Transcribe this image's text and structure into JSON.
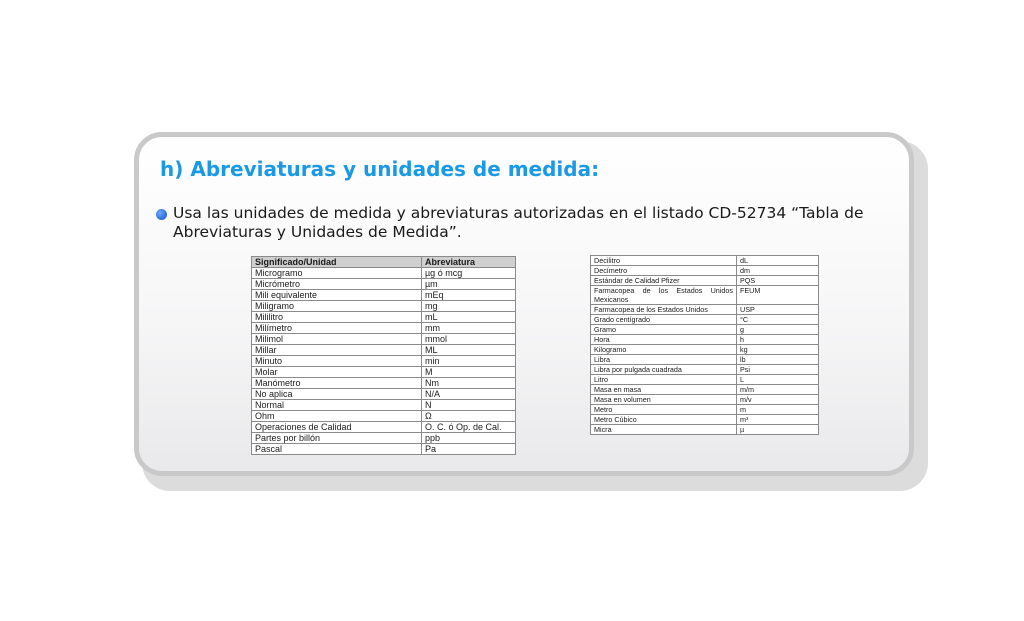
{
  "section": {
    "title": "h) Abreviaturas y unidades de medida:",
    "bullet": "Usa las unidades de medida y abreviaturas autorizadas en el listado CD-52734 “Tabla de Abreviaturas y Unidades de Medida”."
  },
  "table_left": {
    "headers": [
      "Significado/Unidad",
      "Abreviatura"
    ],
    "rows": [
      [
        "Microgramo",
        "µg ó mcg"
      ],
      [
        "Micrómetro",
        "µm"
      ],
      [
        "Mili equivalente",
        "mEq"
      ],
      [
        "Miligramo",
        "mg"
      ],
      [
        "Mililitro",
        "mL"
      ],
      [
        "Milímetro",
        "mm"
      ],
      [
        "Milimol",
        "mmol"
      ],
      [
        "Millar",
        "ML"
      ],
      [
        "Minuto",
        "min"
      ],
      [
        "Molar",
        "M"
      ],
      [
        "Manómetro",
        "Nm"
      ],
      [
        "No aplica",
        "N/A"
      ],
      [
        "Normal",
        "N"
      ],
      [
        "Ohm",
        "Ω"
      ],
      [
        "Operaciones de Calidad",
        "O. C. ó Op. de Cal."
      ],
      [
        "Partes por billón",
        "ppb"
      ],
      [
        "Pascal",
        "Pa"
      ]
    ]
  },
  "table_right": {
    "rows": [
      [
        "Decilitro",
        "dL"
      ],
      [
        "Decímetro",
        "dm"
      ],
      [
        "Estándar de Calidad Pfizer",
        "PQS"
      ],
      [
        "Farmacopea de los Estados Unidos Mexicanos",
        "FEUM"
      ],
      [
        "Farmacopea de los Estados Unidos",
        "USP"
      ],
      [
        "Grado centígrado",
        "°C"
      ],
      [
        "Gramo",
        "g"
      ],
      [
        "Hora",
        "h"
      ],
      [
        "Kilogramo",
        "kg"
      ],
      [
        "Libra",
        "lb"
      ],
      [
        "Libra por pulgada cuadrada",
        "Psi"
      ],
      [
        "Litro",
        "L"
      ],
      [
        "Masa en masa",
        "m/m"
      ],
      [
        "Masa en volumen",
        "m/v"
      ],
      [
        "Metro",
        "m"
      ],
      [
        "Metro Cúbico",
        "m³"
      ],
      [
        "Micra",
        "µ"
      ]
    ]
  }
}
